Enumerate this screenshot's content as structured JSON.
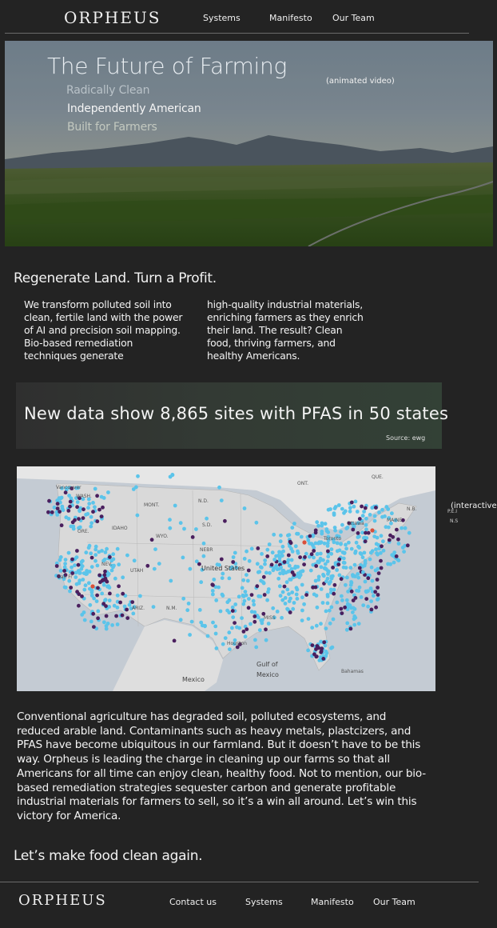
{
  "header": {
    "logo": "ORPHEUS",
    "nav": [
      "Systems",
      "Manifesto",
      "Our Team"
    ]
  },
  "hero": {
    "title": "The Future of Farming",
    "lines": [
      "Radically Clean",
      "Independently American",
      "Built for Farmers"
    ],
    "note": "(animated video)"
  },
  "intro": {
    "heading": "Regenerate Land. Turn a Profit.",
    "col1": "We transform polluted soil into clean, fertile land with the power of AI and precision soil mapping. Bio-based remediation techniques generate",
    "col2": "high-quality industrial materials, enriching farmers as they enrich their land. The result? Clean food, thriving farmers, and healthy Americans."
  },
  "pfas": {
    "headline": "New data show 8,865 sites with PFAS in 50 states",
    "source": "Source: ewg"
  },
  "map": {
    "note": "(interactive",
    "labels": {
      "ont": "ONT.",
      "que": "QUE.",
      "mont": "MONT.",
      "nd": "N.D.",
      "sd": "S.D.",
      "idaho": "IDAHO",
      "wyo": "WYO.",
      "nebr": "NEBR",
      "nev": "NEV.",
      "utah": "UTAH",
      "us": "United States",
      "ariz": "ARIZ.",
      "nm": "N.M.",
      "miss": "MISS",
      "houston": "Houston",
      "gulf1": "Gulf of",
      "gulf2": "Mexico",
      "mexico": "Mexico",
      "ottawa": "Ottawa",
      "toronto": "Toronto",
      "maine": "MAINE",
      "nb": "N.B.",
      "vancouver": "Vancouver",
      "wash": "WASH.",
      "ore": "ORE.",
      "sanfran": "San Fr",
      "bahamas": "Bahamas",
      "pei": "P.E.I",
      "ns": "N.S"
    }
  },
  "body": {
    "paragraph": " Conventional agriculture has degraded soil, polluted ecosystems, and reduced arable land. Contaminants such as heavy metals, plastcizers, and PFAS have become ubiquitous in our farmland. But it doesn’t have to be this way. Orpheus is leading the charge in cleaning up our farms so that all Americans for all time can enjoy clean, healthy food. Not to mention, our bio-based remediation strategies sequester carbon and generate profitable industrial materials for farmers to sell, so it’s a win all around. Let’s win this victory for America.",
    "closing": "Let’s make food clean again."
  },
  "footer": {
    "logo": "ORPHEUS",
    "nav": [
      "Contact us",
      "Systems",
      "Manifesto",
      "Our Team"
    ]
  },
  "colors": {
    "background": "#232323",
    "marker_light": "#5bc4ea",
    "marker_dark": "#4a1f5e",
    "marker_red": "#d9503a"
  }
}
